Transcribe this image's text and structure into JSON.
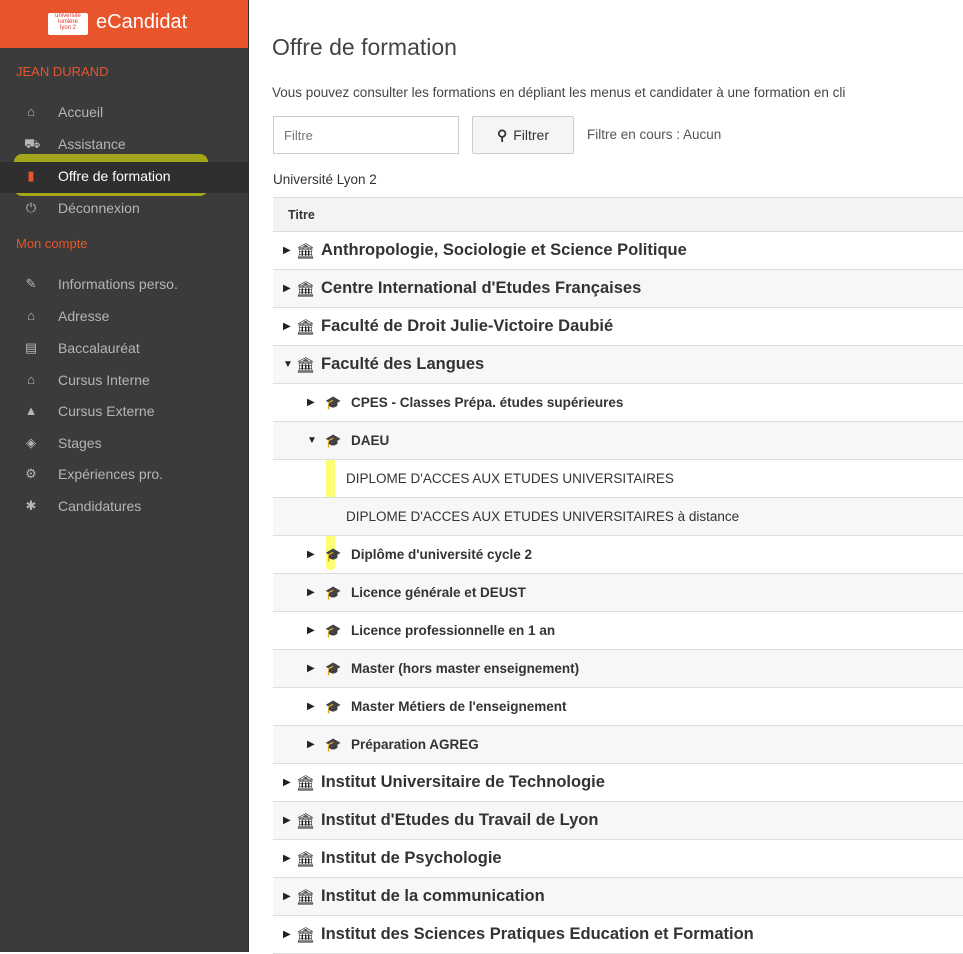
{
  "sidebar": {
    "app_title": "eCandidat",
    "logo_text": [
      "université",
      "lumière",
      "lyon 2"
    ],
    "user_name": "JEAN DURAND",
    "main_items": [
      {
        "label": "Accueil",
        "icon": "home-icon"
      },
      {
        "label": "Assistance",
        "icon": "ambulance-icon"
      },
      {
        "label": "Offre de formation",
        "icon": "bookmark-icon",
        "active": true
      },
      {
        "label": "Déconnexion",
        "icon": "power-icon"
      }
    ],
    "section_label": "Mon compte",
    "account_items": [
      {
        "label": "Informations perso.",
        "icon": "pencil-icon"
      },
      {
        "label": "Adresse",
        "icon": "home-icon"
      },
      {
        "label": "Baccalauréat",
        "icon": "book-icon"
      },
      {
        "label": "Cursus Interne",
        "icon": "institution-icon"
      },
      {
        "label": "Cursus Externe",
        "icon": "graduation-cap-icon"
      },
      {
        "label": "Stages",
        "icon": "cube-icon"
      },
      {
        "label": "Expériences pro.",
        "icon": "cogs-icon"
      },
      {
        "label": "Candidatures",
        "icon": "asterisk-icon"
      }
    ]
  },
  "main": {
    "title": "Offre de formation",
    "intro": "Vous pouvez consulter les formations en dépliant les menus et candidater à une formation en cli",
    "filter_placeholder": "Filtre",
    "filter_button": "Filtrer",
    "filter_status": "Filtre en cours : Aucun",
    "university": "Université Lyon 2",
    "table_header": "Titre",
    "rows": [
      {
        "level": 1,
        "label": "Anthropologie, Sociologie et Science Politique",
        "expanded": false
      },
      {
        "level": 1,
        "label": "Centre International d'Etudes Françaises",
        "expanded": false
      },
      {
        "level": 1,
        "label": "Faculté de Droit Julie-Victoire Daubié",
        "expanded": false
      },
      {
        "level": 1,
        "label": "Faculté des Langues",
        "expanded": true
      },
      {
        "level": 2,
        "label": "CPES - Classes Prépa. études supérieures",
        "expanded": false
      },
      {
        "level": 2,
        "label": "DAEU",
        "expanded": true
      },
      {
        "level": 3,
        "label": "DIPLOME D'ACCES AUX ETUDES UNIVERSITAIRES"
      },
      {
        "level": 3,
        "label": "DIPLOME D'ACCES AUX ETUDES UNIVERSITAIRES à distance"
      },
      {
        "level": 2,
        "label": "Diplôme d'université cycle 2",
        "expanded": false
      },
      {
        "level": 2,
        "label": "Licence générale et DEUST",
        "expanded": false
      },
      {
        "level": 2,
        "label": "Licence professionnelle en 1 an",
        "expanded": false
      },
      {
        "level": 2,
        "label": "Master (hors master enseignement)",
        "expanded": false
      },
      {
        "level": 2,
        "label": "Master Métiers de l'enseignement",
        "expanded": false
      },
      {
        "level": 2,
        "label": "Préparation AGREG",
        "expanded": false
      },
      {
        "level": 1,
        "label": "Institut Universitaire de Technologie",
        "expanded": false
      },
      {
        "level": 1,
        "label": "Institut d'Etudes du Travail de Lyon",
        "expanded": false
      },
      {
        "level": 1,
        "label": "Institut de Psychologie",
        "expanded": false
      },
      {
        "level": 1,
        "label": "Institut de la communication",
        "expanded": false
      },
      {
        "level": 1,
        "label": "Institut des Sciences Pratiques Education et Formation",
        "expanded": false
      }
    ]
  },
  "colors": {
    "accent": "#e8542b",
    "sidebar_bg": "#3b3b3b",
    "highlight": "#faff00"
  }
}
